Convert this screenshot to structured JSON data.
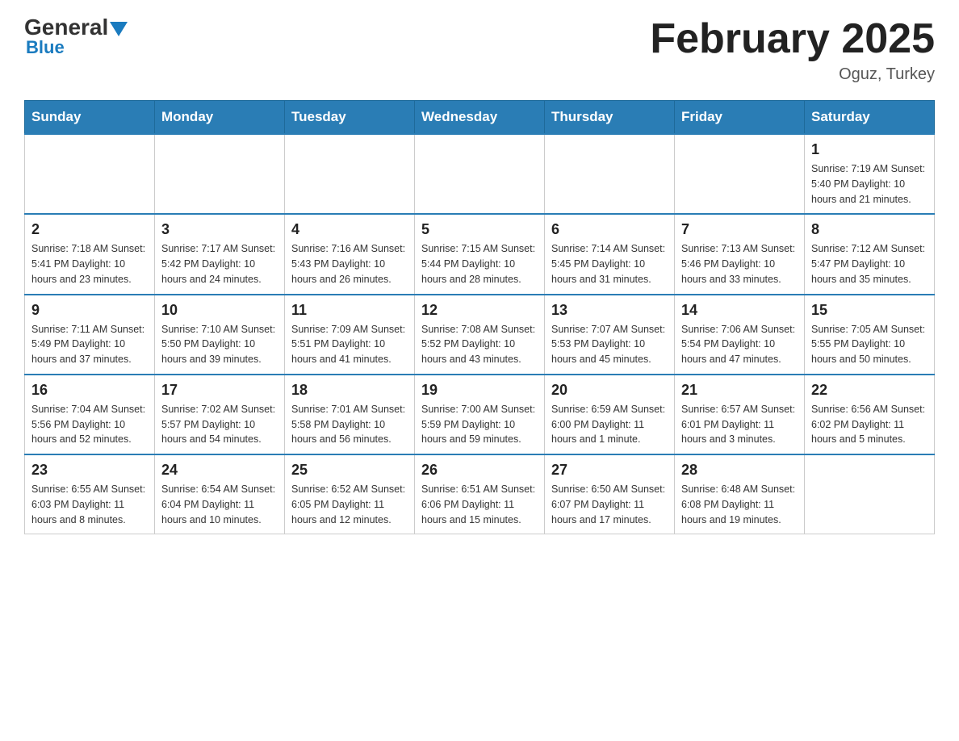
{
  "header": {
    "logo_top": "General",
    "logo_bottom": "Blue",
    "month_title": "February 2025",
    "location": "Oguz, Turkey"
  },
  "weekdays": [
    "Sunday",
    "Monday",
    "Tuesday",
    "Wednesday",
    "Thursday",
    "Friday",
    "Saturday"
  ],
  "weeks": [
    [
      {
        "day": "",
        "info": ""
      },
      {
        "day": "",
        "info": ""
      },
      {
        "day": "",
        "info": ""
      },
      {
        "day": "",
        "info": ""
      },
      {
        "day": "",
        "info": ""
      },
      {
        "day": "",
        "info": ""
      },
      {
        "day": "1",
        "info": "Sunrise: 7:19 AM\nSunset: 5:40 PM\nDaylight: 10 hours and 21 minutes."
      }
    ],
    [
      {
        "day": "2",
        "info": "Sunrise: 7:18 AM\nSunset: 5:41 PM\nDaylight: 10 hours and 23 minutes."
      },
      {
        "day": "3",
        "info": "Sunrise: 7:17 AM\nSunset: 5:42 PM\nDaylight: 10 hours and 24 minutes."
      },
      {
        "day": "4",
        "info": "Sunrise: 7:16 AM\nSunset: 5:43 PM\nDaylight: 10 hours and 26 minutes."
      },
      {
        "day": "5",
        "info": "Sunrise: 7:15 AM\nSunset: 5:44 PM\nDaylight: 10 hours and 28 minutes."
      },
      {
        "day": "6",
        "info": "Sunrise: 7:14 AM\nSunset: 5:45 PM\nDaylight: 10 hours and 31 minutes."
      },
      {
        "day": "7",
        "info": "Sunrise: 7:13 AM\nSunset: 5:46 PM\nDaylight: 10 hours and 33 minutes."
      },
      {
        "day": "8",
        "info": "Sunrise: 7:12 AM\nSunset: 5:47 PM\nDaylight: 10 hours and 35 minutes."
      }
    ],
    [
      {
        "day": "9",
        "info": "Sunrise: 7:11 AM\nSunset: 5:49 PM\nDaylight: 10 hours and 37 minutes."
      },
      {
        "day": "10",
        "info": "Sunrise: 7:10 AM\nSunset: 5:50 PM\nDaylight: 10 hours and 39 minutes."
      },
      {
        "day": "11",
        "info": "Sunrise: 7:09 AM\nSunset: 5:51 PM\nDaylight: 10 hours and 41 minutes."
      },
      {
        "day": "12",
        "info": "Sunrise: 7:08 AM\nSunset: 5:52 PM\nDaylight: 10 hours and 43 minutes."
      },
      {
        "day": "13",
        "info": "Sunrise: 7:07 AM\nSunset: 5:53 PM\nDaylight: 10 hours and 45 minutes."
      },
      {
        "day": "14",
        "info": "Sunrise: 7:06 AM\nSunset: 5:54 PM\nDaylight: 10 hours and 47 minutes."
      },
      {
        "day": "15",
        "info": "Sunrise: 7:05 AM\nSunset: 5:55 PM\nDaylight: 10 hours and 50 minutes."
      }
    ],
    [
      {
        "day": "16",
        "info": "Sunrise: 7:04 AM\nSunset: 5:56 PM\nDaylight: 10 hours and 52 minutes."
      },
      {
        "day": "17",
        "info": "Sunrise: 7:02 AM\nSunset: 5:57 PM\nDaylight: 10 hours and 54 minutes."
      },
      {
        "day": "18",
        "info": "Sunrise: 7:01 AM\nSunset: 5:58 PM\nDaylight: 10 hours and 56 minutes."
      },
      {
        "day": "19",
        "info": "Sunrise: 7:00 AM\nSunset: 5:59 PM\nDaylight: 10 hours and 59 minutes."
      },
      {
        "day": "20",
        "info": "Sunrise: 6:59 AM\nSunset: 6:00 PM\nDaylight: 11 hours and 1 minute."
      },
      {
        "day": "21",
        "info": "Sunrise: 6:57 AM\nSunset: 6:01 PM\nDaylight: 11 hours and 3 minutes."
      },
      {
        "day": "22",
        "info": "Sunrise: 6:56 AM\nSunset: 6:02 PM\nDaylight: 11 hours and 5 minutes."
      }
    ],
    [
      {
        "day": "23",
        "info": "Sunrise: 6:55 AM\nSunset: 6:03 PM\nDaylight: 11 hours and 8 minutes."
      },
      {
        "day": "24",
        "info": "Sunrise: 6:54 AM\nSunset: 6:04 PM\nDaylight: 11 hours and 10 minutes."
      },
      {
        "day": "25",
        "info": "Sunrise: 6:52 AM\nSunset: 6:05 PM\nDaylight: 11 hours and 12 minutes."
      },
      {
        "day": "26",
        "info": "Sunrise: 6:51 AM\nSunset: 6:06 PM\nDaylight: 11 hours and 15 minutes."
      },
      {
        "day": "27",
        "info": "Sunrise: 6:50 AM\nSunset: 6:07 PM\nDaylight: 11 hours and 17 minutes."
      },
      {
        "day": "28",
        "info": "Sunrise: 6:48 AM\nSunset: 6:08 PM\nDaylight: 11 hours and 19 minutes."
      },
      {
        "day": "",
        "info": ""
      }
    ]
  ]
}
